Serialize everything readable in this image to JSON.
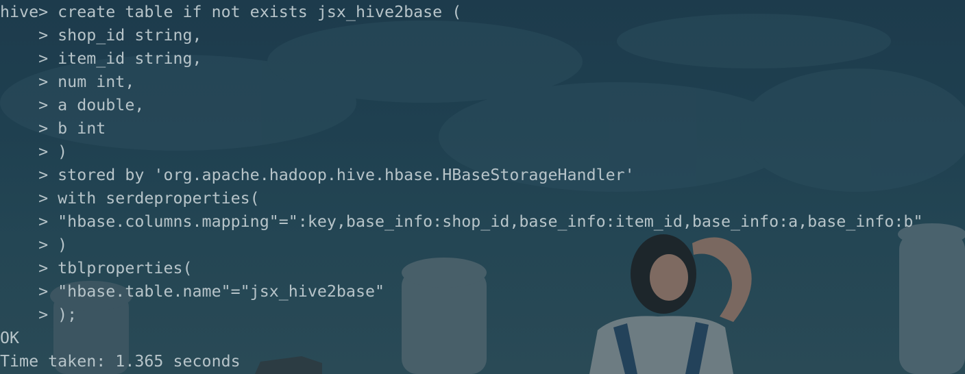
{
  "terminal": {
    "lines": [
      {
        "prompt": "hive> ",
        "text": "create table if not exists jsx_hive2base ("
      },
      {
        "prompt": "    > ",
        "text": "shop_id string,"
      },
      {
        "prompt": "    > ",
        "text": "item_id string,"
      },
      {
        "prompt": "    > ",
        "text": "num int,"
      },
      {
        "prompt": "    > ",
        "text": "a double,"
      },
      {
        "prompt": "    > ",
        "text": "b int"
      },
      {
        "prompt": "    > ",
        "text": ")"
      },
      {
        "prompt": "    > ",
        "text": "stored by 'org.apache.hadoop.hive.hbase.HBaseStorageHandler'"
      },
      {
        "prompt": "    > ",
        "text": "with serdeproperties("
      },
      {
        "prompt": "    > ",
        "text": "\"hbase.columns.mapping\"=\":key,base_info:shop_id,base_info:item_id,base_info:a,base_info:b\""
      },
      {
        "prompt": "    > ",
        "text": ")"
      },
      {
        "prompt": "    > ",
        "text": "tblproperties("
      },
      {
        "prompt": "    > ",
        "text": "\"hbase.table.name\"=\"jsx_hive2base\""
      },
      {
        "prompt": "    > ",
        "text": ");"
      },
      {
        "prompt": "",
        "text": "OK"
      },
      {
        "prompt": "",
        "text": "Time taken: 1.365 seconds"
      }
    ]
  },
  "colors": {
    "text": "#b7c4c9",
    "background": "#1e3a4a"
  }
}
